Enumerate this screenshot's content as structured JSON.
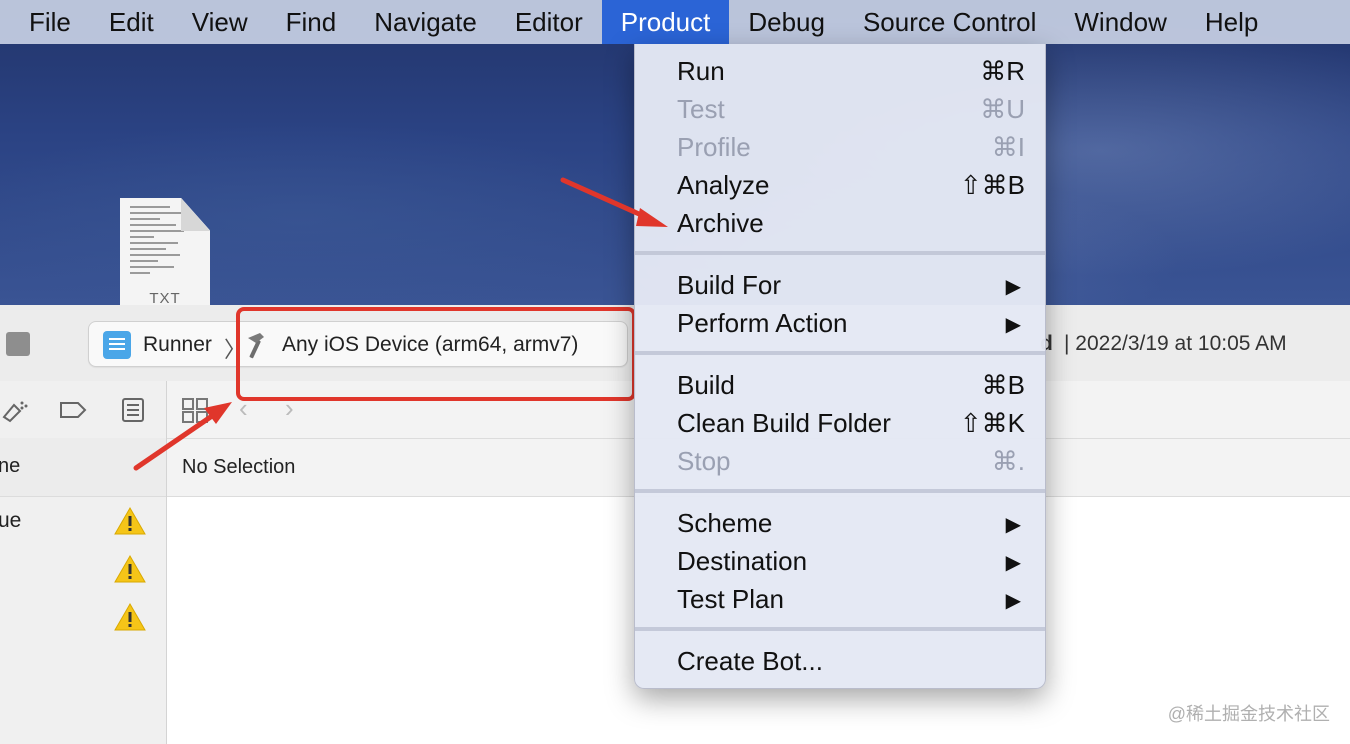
{
  "menubar": {
    "items": [
      "File",
      "Edit",
      "View",
      "Find",
      "Navigate",
      "Editor",
      "Product",
      "Debug",
      "Source Control",
      "Window",
      "Help"
    ],
    "active": "Product"
  },
  "desktop": {
    "file_label": "TXT"
  },
  "toolbar": {
    "scheme": "Runner",
    "device": "Any iOS Device (arm64, armv7)",
    "status_bold": "d",
    "status_text": "| 2022/3/19 at 10:05 AM"
  },
  "navigator": {
    "header": "ne",
    "issue_label": "ue"
  },
  "editor": {
    "jump_text": "No Selection"
  },
  "product_menu": {
    "groups": [
      [
        {
          "label": "Run",
          "shortcut": "⌘R",
          "enabled": true
        },
        {
          "label": "Test",
          "shortcut": "⌘U",
          "enabled": false
        },
        {
          "label": "Profile",
          "shortcut": "⌘I",
          "enabled": false
        },
        {
          "label": "Analyze",
          "shortcut": "⇧⌘B",
          "enabled": true
        },
        {
          "label": "Archive",
          "shortcut": "",
          "enabled": true
        }
      ],
      [
        {
          "label": "Build For",
          "submenu": true,
          "enabled": true
        },
        {
          "label": "Perform Action",
          "submenu": true,
          "enabled": true
        }
      ],
      [
        {
          "label": "Build",
          "shortcut": "⌘B",
          "enabled": true
        },
        {
          "label": "Clean Build Folder",
          "shortcut": "⇧⌘K",
          "enabled": true
        },
        {
          "label": "Stop",
          "shortcut": "⌘.",
          "enabled": false
        }
      ],
      [
        {
          "label": "Scheme",
          "submenu": true,
          "enabled": true
        },
        {
          "label": "Destination",
          "submenu": true,
          "enabled": true
        },
        {
          "label": "Test Plan",
          "submenu": true,
          "enabled": true
        }
      ],
      [
        {
          "label": "Create Bot...",
          "shortcut": "",
          "enabled": true
        }
      ]
    ],
    "submenu_arrow": "▶"
  },
  "colors": {
    "menu_highlight": "#2b64d6",
    "annotation_red": "#e0362b",
    "warning_yellow": "#f5c518"
  },
  "watermark": "@稀土掘金技术社区"
}
